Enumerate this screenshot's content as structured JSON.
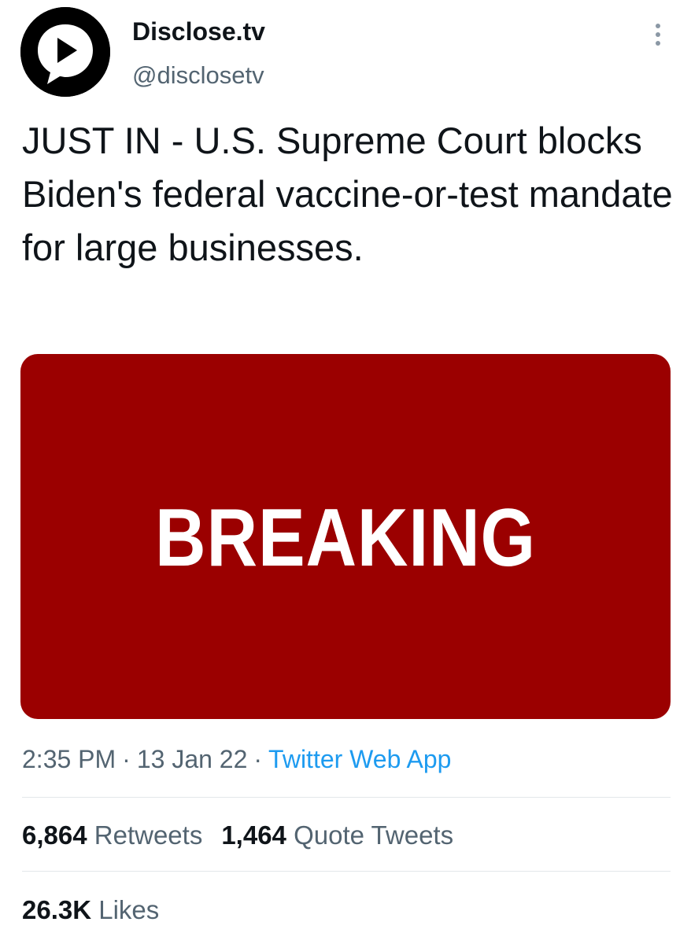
{
  "author": {
    "display_name": "Disclose.tv",
    "handle": "@disclosetv",
    "avatar_icon": "disclose-play-bubble-icon"
  },
  "more_icon": "more-vertical-icon",
  "tweet": {
    "text": "JUST IN - U.S. Supreme Court blocks Biden's federal vaccine-or-test mandate for large businesses."
  },
  "media": {
    "text": "BREAKING",
    "background_color": "#9b0000",
    "text_color": "#ffffff"
  },
  "meta": {
    "time": "2:35 PM",
    "separator": "·",
    "date": "13 Jan 22",
    "source": "Twitter Web App",
    "source_color": "#1d9bf0"
  },
  "stats": {
    "retweets_count": "6,864",
    "retweets_label": "Retweets",
    "quotes_count": "1,464",
    "quotes_label": "Quote Tweets",
    "likes_count": "26.3K",
    "likes_label": "Likes"
  }
}
